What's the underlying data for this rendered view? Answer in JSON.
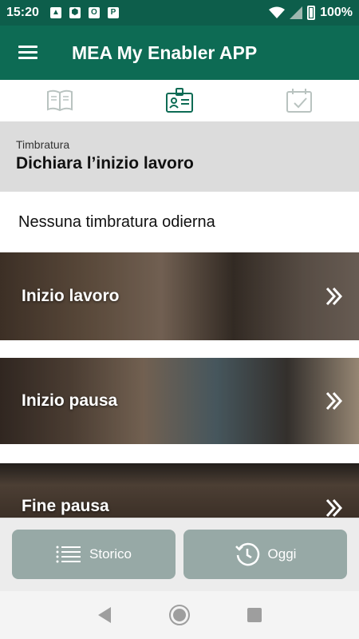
{
  "status_bar": {
    "time": "15:20",
    "battery_percent": "100%",
    "icons": [
      "image-icon",
      "hexagon-icon",
      "outlook-icon",
      "p-icon"
    ]
  },
  "app_bar": {
    "title": "MEA My Enabler APP"
  },
  "tabs": [
    {
      "name": "book-icon",
      "active": false
    },
    {
      "name": "id-badge-icon",
      "active": true
    },
    {
      "name": "calendar-check-icon",
      "active": false
    }
  ],
  "section": {
    "label": "Timbratura",
    "title": "Dichiara l’inizio lavoro"
  },
  "notice": {
    "text": "Nessuna timbratura odierna"
  },
  "cards": [
    {
      "label": "Inizio lavoro"
    },
    {
      "label": "Inizio pausa"
    },
    {
      "label": "Fine pausa"
    }
  ],
  "buttons": {
    "storico": "Storico",
    "oggi": "Oggi"
  },
  "colors": {
    "app_bar": "#0d6b54",
    "status_bar": "#0d5e4b",
    "button": "#97a9a6"
  }
}
